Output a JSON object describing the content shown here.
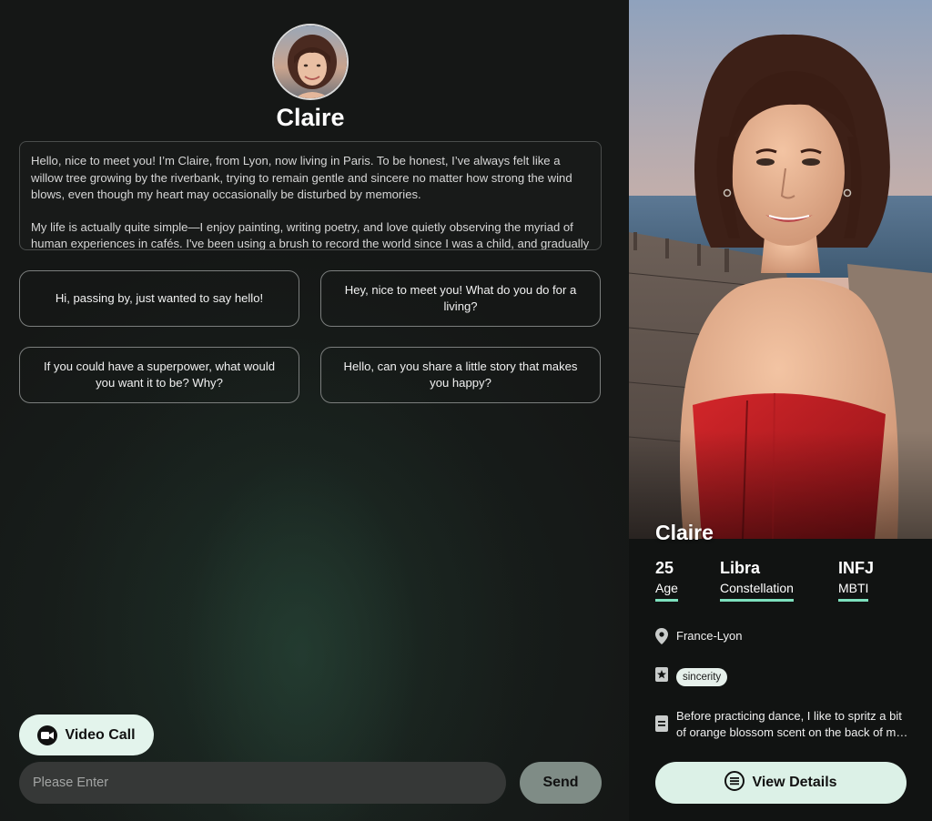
{
  "chat": {
    "character_name": "Claire",
    "intro_paragraphs": [
      "Hello, nice to meet you! I’m Claire, from Lyon, now living in Paris. To be honest, I’ve always felt like a willow tree growing by the riverbank, trying to remain gentle and sincere no matter how strong the wind blows, even though my heart may occasionally be disturbed by memories.",
      "My life is actually quite simple—I enjoy painting, writing poetry, and love quietly observing the myriad of human experiences in cafés. I've been using a brush to record the world since I was a child, and gradually"
    ],
    "suggestions": [
      "Hi, passing by, just wanted to say hello!",
      "Hey, nice to meet you! What do you do for a living?",
      "If you could have a superpower, what would you want it to be? Why?",
      "Hello, can you share a little story that makes you happy?"
    ],
    "video_call_label": "Video Call",
    "input_placeholder": "Please Enter",
    "send_label": "Send"
  },
  "profile": {
    "name": "Claire",
    "stats": {
      "age_value": "25",
      "age_label": "Age",
      "constellation_value": "Libra",
      "constellation_label": "Constellation",
      "mbti_value": "INFJ",
      "mbti_label": "MBTI"
    },
    "location": "France-Lyon",
    "tag": "sincerity",
    "bio_lines": [
      "Before practicing dance, I like to spritz a bit",
      "of orange blossom scent on the back of my neck."
    ],
    "details_label": "View Details"
  },
  "colors": {
    "accent_underline": "#7de0bd",
    "button_light": "#e3f4ec",
    "send_button": "#7f8c86",
    "background": "#151716"
  },
  "icons": [
    "video-camera-icon",
    "location-pin-icon",
    "star-icon",
    "document-icon",
    "list-circle-icon"
  ]
}
